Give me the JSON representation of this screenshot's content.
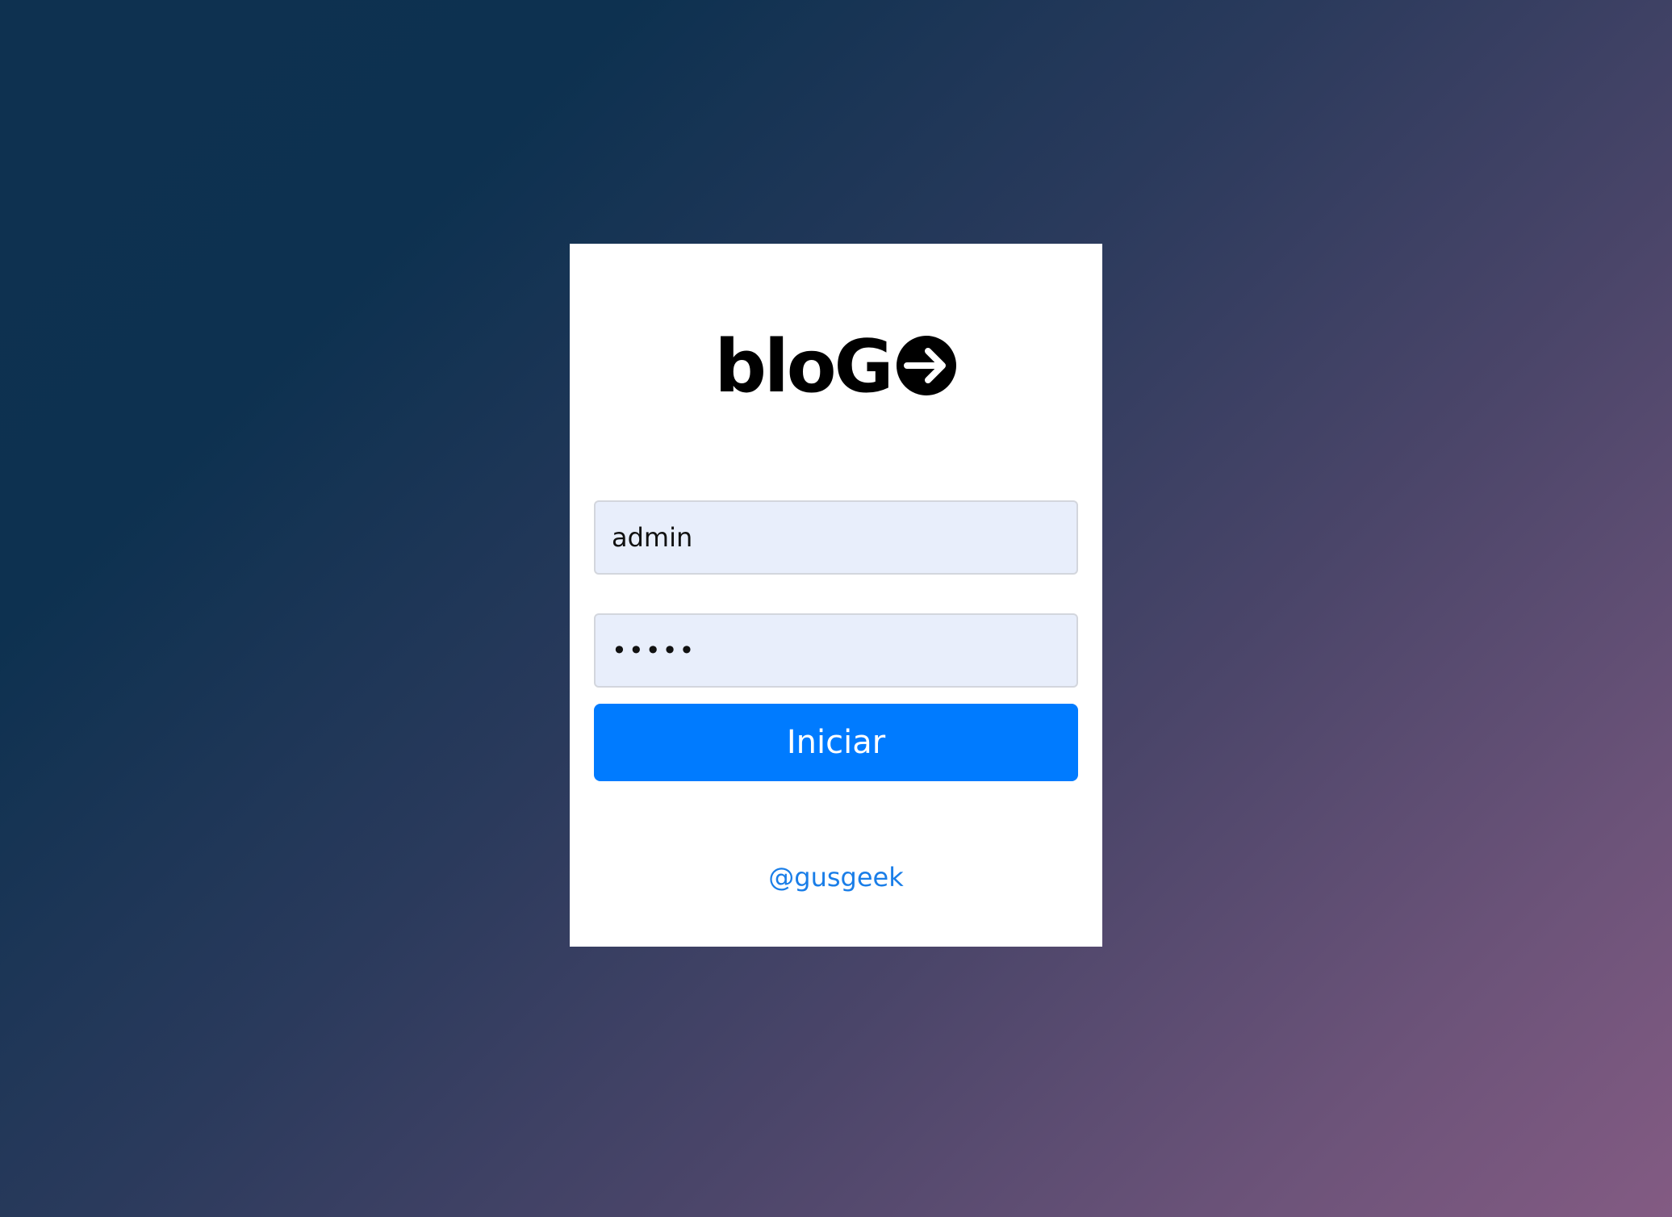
{
  "logo": {
    "text": "bloG",
    "icon": "arrow-right-circle-icon"
  },
  "form": {
    "username_value": "admin",
    "password_value": "•••••",
    "submit_label": "Iniciar"
  },
  "footer": {
    "handle": "@gusgeek"
  },
  "colors": {
    "primary": "#007bff",
    "link": "#1a7ee8",
    "input_bg": "#e8eefb"
  }
}
